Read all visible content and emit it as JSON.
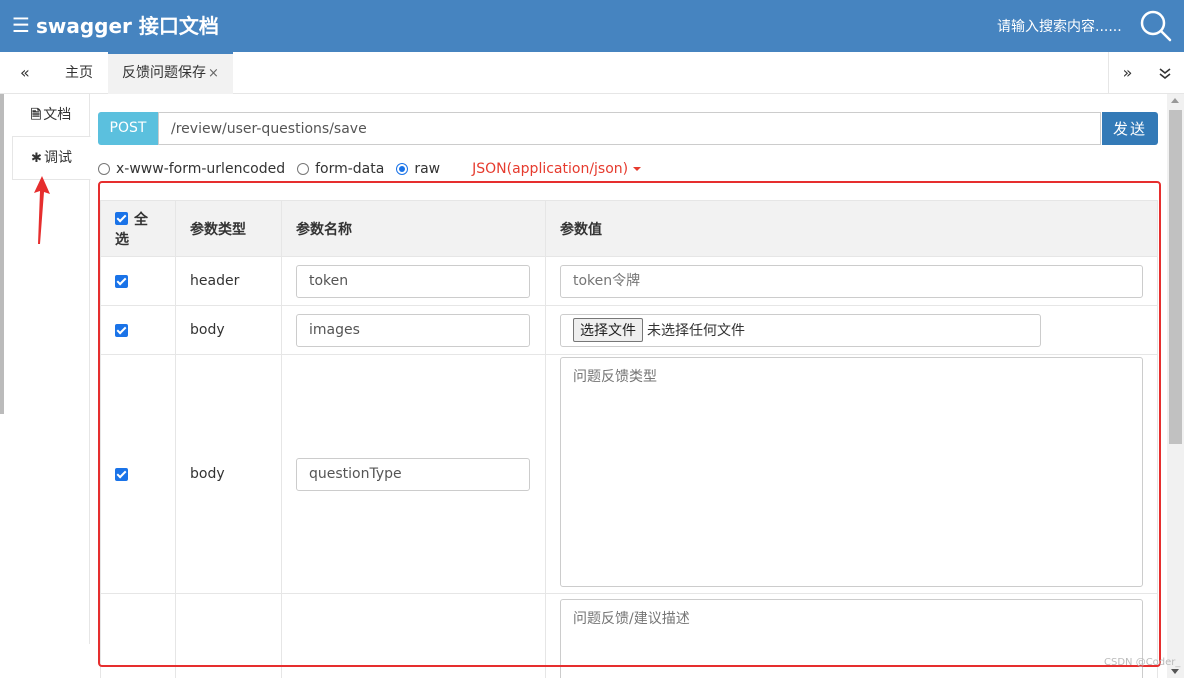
{
  "header": {
    "icon": "menu-lines-icon",
    "title": "swagger 接口文档",
    "search_placeholder": "请输入搜索内容......"
  },
  "tabs": {
    "nav_left": "«",
    "home": "主页",
    "active": "反馈问题保存",
    "close": "×",
    "nav_right": "»",
    "more": "»"
  },
  "side": {
    "doc": "文档",
    "debug": "调试"
  },
  "request": {
    "method": "POST",
    "url": "/review/user-questions/save",
    "send": "发送"
  },
  "body_types": {
    "urlencoded": "x-www-form-urlencoded",
    "form_data": "form-data",
    "raw": "raw",
    "selected": "raw",
    "content_type": "JSON(application/json)"
  },
  "table": {
    "headers": {
      "select_all": "全选",
      "param_type": "参数类型",
      "param_name": "参数名称",
      "param_value": "参数值"
    },
    "rows": [
      {
        "type": "header",
        "name": "token",
        "value_placeholder": "token令牌"
      },
      {
        "type": "body",
        "name": "images",
        "file_button": "选择文件",
        "file_status": "未选择任何文件"
      },
      {
        "type": "body",
        "name": "questionType",
        "value_placeholder": "问题反馈类型"
      },
      {
        "value_placeholder": "问题反馈/建议描述"
      }
    ]
  },
  "colors": {
    "header_bg": "#4684c0",
    "method_bg": "#5bc0de",
    "send_bg": "#337ab7",
    "highlight": "#e62e2e",
    "checkbox": "#1a73e8"
  },
  "watermark": "CSDN @Coder_"
}
